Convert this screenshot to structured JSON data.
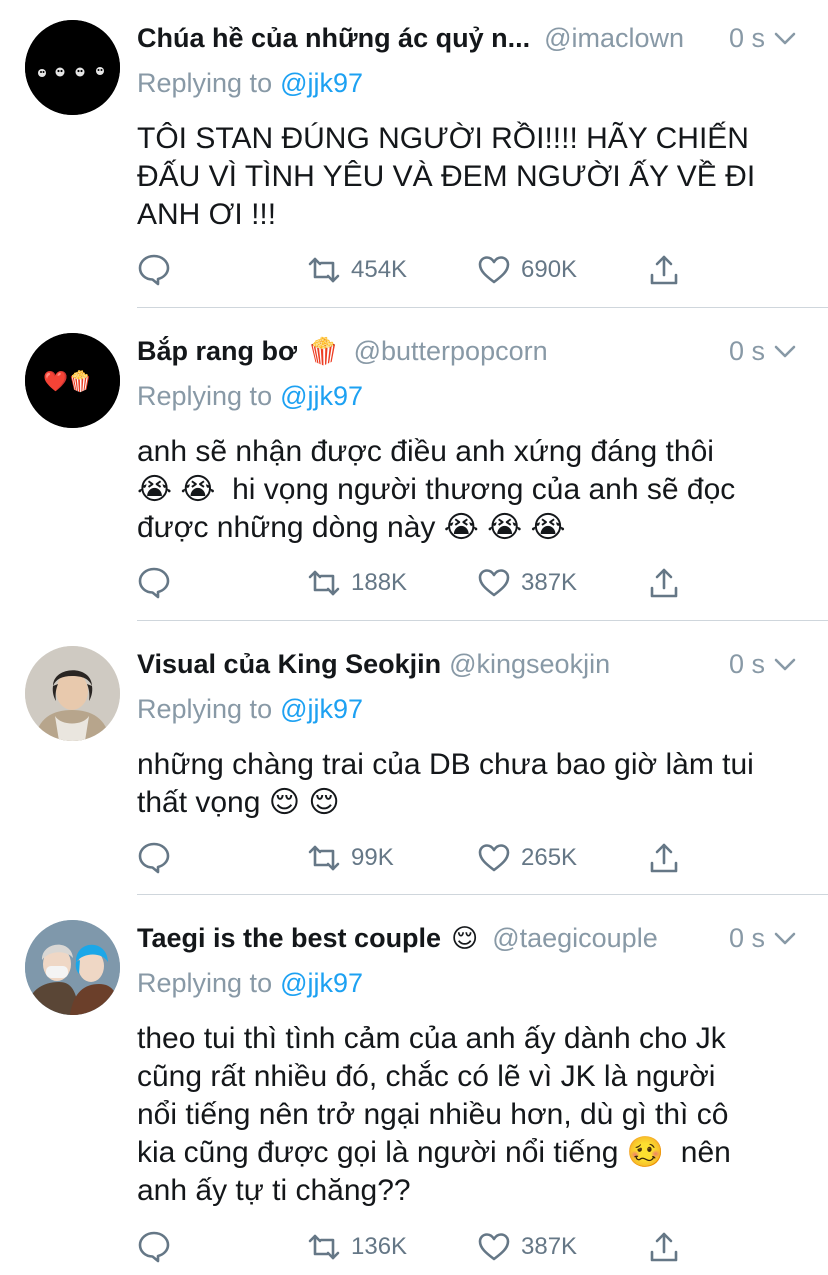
{
  "reply_prefix": "Replying to",
  "tweets": [
    {
      "name": "Chúa hề của những ác quỷ n...",
      "name_emoji": "",
      "handle": "@imaclown",
      "time": "0 s",
      "reply_to": "@jjk97",
      "text": "TÔI STAN ĐÚNG NGƯỜI RỒI!!!! HÃY CHIẾN\nĐẤU VÌ TÌNH YÊU VÀ ĐEM NGƯỜI ẤY VỀ ĐI\nANH ƠI !!!",
      "retweets": "454K",
      "likes": "690K"
    },
    {
      "name": "Bắp rang bơ",
      "name_emoji": "🍿",
      "handle": "@butterpopcorn",
      "time": "0 s",
      "reply_to": "@jjk97",
      "text": "anh sẽ nhận được điều anh xứng đáng thôi\n😭 😭  hi vọng người thương của anh sẽ đọc\nđược những dòng này 😭 😭 😭",
      "retweets": "188K",
      "likes": "387K"
    },
    {
      "name": "Visual của King Seokjin",
      "name_emoji": "",
      "handle": "@kingseokjin",
      "time": "0 s",
      "reply_to": "@jjk97",
      "text": "những chàng trai của DB chưa bao giờ làm tui\nthất vọng 😌 😌",
      "retweets": "99K",
      "likes": "265K"
    },
    {
      "name": "Taegi is the best couple",
      "name_emoji": "😌",
      "handle": "@taegicouple",
      "time": "0 s",
      "reply_to": "@jjk97",
      "text": "theo tui thì tình cảm của anh ấy dành cho Jk\ncũng rất nhiều đó, chắc có lẽ vì JK là người\nnổi tiếng nên trở ngại nhiều hơn, dù gì thì cô\nkia cũng được gọi là người nổi tiếng 🥴  nên\nanh ấy tự ti chăng??",
      "retweets": "136K",
      "likes": "387K"
    }
  ],
  "avatar_emoji": {
    "tweet_1": "❤️🍿"
  },
  "icons": {
    "reply": "speech-bubble-icon",
    "retweet": "retweet-arrows-icon",
    "like": "heart-outline-icon",
    "share": "share-arrow-up-icon",
    "caret": "chevron-down-icon"
  },
  "colors": {
    "accent": "#1da1f2",
    "muted": "#8899a6",
    "icon": "#657786",
    "divider": "#cfd6dc"
  }
}
